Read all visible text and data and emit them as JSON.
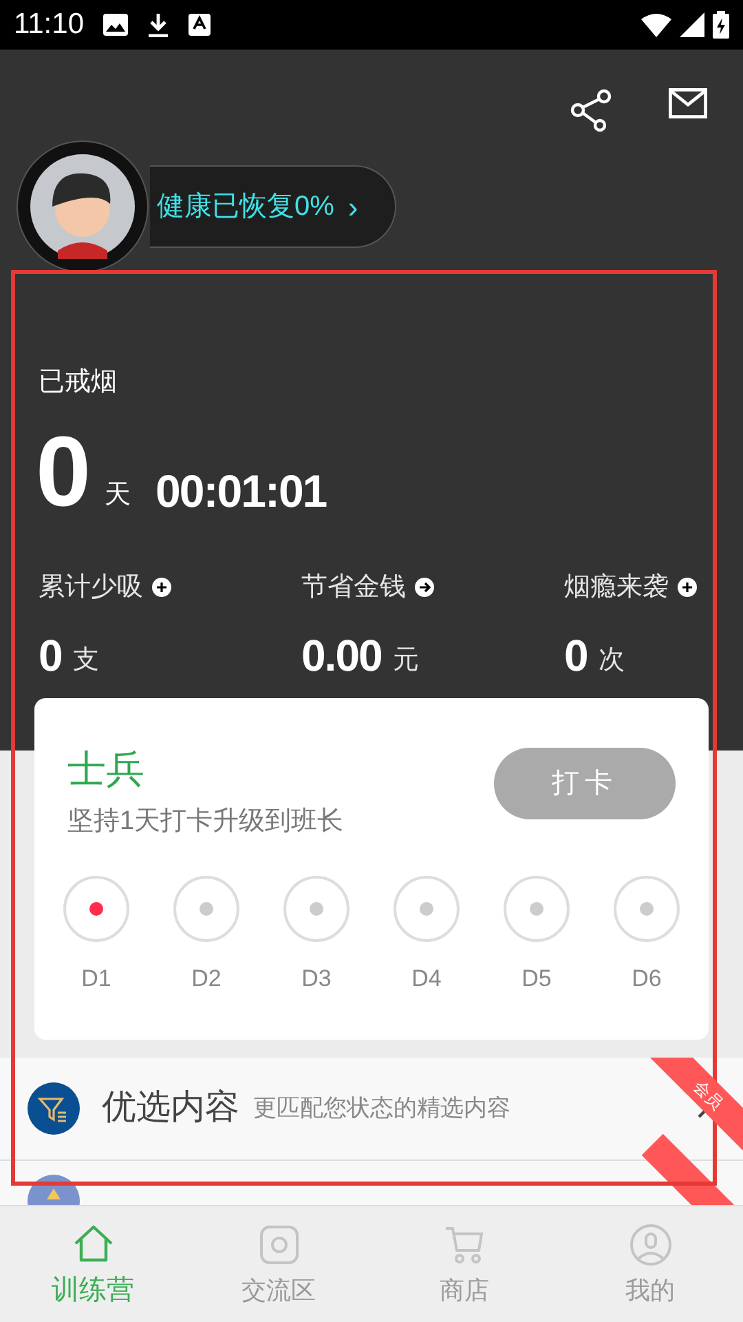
{
  "status_bar": {
    "time": "11:10"
  },
  "profile": {
    "health_text": "健康已恢复0%",
    "chevron": "›"
  },
  "quit": {
    "label": "已戒烟",
    "days": "0",
    "days_unit": "天",
    "time": "00:01:01"
  },
  "stats": [
    {
      "label": "累计少吸",
      "kind": "plus",
      "value": "0",
      "unit": "支"
    },
    {
      "label": "节省金钱",
      "kind": "arrow",
      "value": "0.00",
      "unit": "元"
    },
    {
      "label": "烟瘾来袭",
      "kind": "plus",
      "value": "0",
      "unit": "次"
    }
  ],
  "checkin": {
    "rank": "士兵",
    "hint": "坚持1天打卡升级到班长",
    "button": "打卡",
    "days": [
      {
        "label": "D1",
        "selected": true
      },
      {
        "label": "D2",
        "selected": false
      },
      {
        "label": "D3",
        "selected": false
      },
      {
        "label": "D4",
        "selected": false
      },
      {
        "label": "D5",
        "selected": false
      },
      {
        "label": "D6",
        "selected": false
      }
    ]
  },
  "list": [
    {
      "title": "优选内容",
      "subtitle": "更匹配您状态的精选内容",
      "ribbon": "会员"
    }
  ],
  "tabs": [
    {
      "label": "训练营",
      "kind": "home",
      "selected": true
    },
    {
      "label": "交流区",
      "kind": "square",
      "selected": false
    },
    {
      "label": "商店",
      "kind": "cart",
      "selected": false
    },
    {
      "label": "我的",
      "kind": "user",
      "selected": false
    }
  ]
}
